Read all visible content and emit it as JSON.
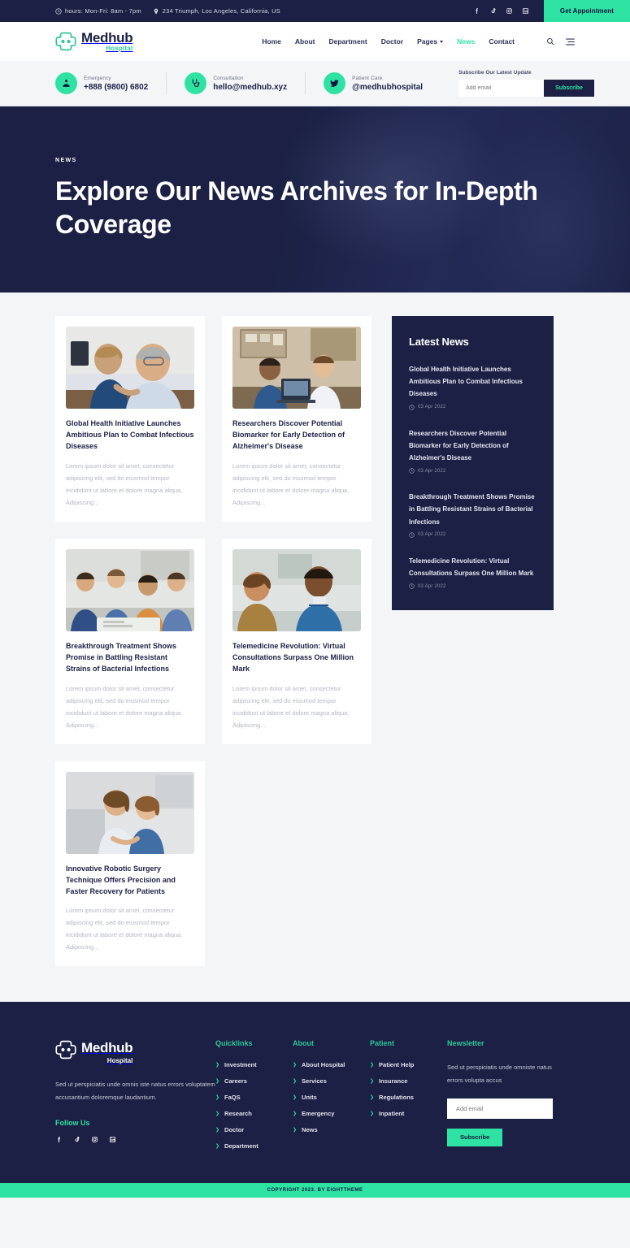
{
  "topbar": {
    "hours": "hours: Mon-Fri: 8am - 7pm",
    "address": "234 Triumph, Los Angeles, California, US",
    "clock_icon": "clock-icon",
    "pin_icon": "map-pin-icon",
    "socials": [
      "facebook-icon",
      "tiktok-icon",
      "instagram-icon",
      "linkedin-icon"
    ],
    "appointment_label": "Get Appointment"
  },
  "header": {
    "logo_name": "Medhub",
    "logo_sub": "Hospital",
    "nav": [
      {
        "label": "Home",
        "active": false,
        "caret": false
      },
      {
        "label": "About",
        "active": false,
        "caret": false
      },
      {
        "label": "Department",
        "active": false,
        "caret": false
      },
      {
        "label": "Doctor",
        "active": false,
        "caret": false
      },
      {
        "label": "Pages",
        "active": false,
        "caret": true
      },
      {
        "label": "News",
        "active": true,
        "caret": false
      },
      {
        "label": "Contact",
        "active": false,
        "caret": false
      }
    ],
    "search_icon": "search-icon",
    "menu_icon": "hamburger-menu-icon"
  },
  "infobar": {
    "items": [
      {
        "label": "Emergency",
        "value": "+888 (9800) 6802",
        "icon": "ambulance-icon"
      },
      {
        "label": "Consultation",
        "value": "hello@medhub.xyz",
        "icon": "stethoscope-icon"
      },
      {
        "label": "Patient Care",
        "value": "@medhubhospital",
        "icon": "twitter-bird-icon"
      }
    ],
    "subscribe_title": "Subscribe Our Latest Update",
    "email_placeholder": "Add email",
    "subscribe_label": "Subscribe"
  },
  "hero": {
    "eyebrow": "NEWS",
    "title": "Explore Our News Archives for In-Depth Coverage"
  },
  "articles": [
    {
      "title": "Global Health Initiative Launches Ambitious Plan to Combat Infectious Diseases",
      "excerpt": "Lorem ipsum dolor sit amet, consectetur adipiscing elit, sed do eiusmod tempor incididunt ut labore et dolore magna aliqua. Adipiscing...",
      "image": "nurse-comforting-elderly-patient"
    },
    {
      "title": "Researchers Discover Potential Biomarker for Early Detection of Alzheimer's Disease",
      "excerpt": "Lorem ipsum dolor sit amet, consectetur adipiscing elit, sed do eiusmod tempor incididunt ut labore et dolore magna aliqua. Adipiscing...",
      "image": "doctors-reviewing-scan-at-desk"
    },
    {
      "title": "Breakthrough Treatment Shows Promise in Battling Resistant Strains of Bacterial Infections",
      "excerpt": "Lorem ipsum dolor sit amet, consectetur adipiscing elit, sed do eiusmod tempor incididunt ut labore et dolore magna aliqua. Adipiscing...",
      "image": "medical-team-meeting-with-patient"
    },
    {
      "title": "Telemedicine Revolution: Virtual Consultations Surpass One Million Mark",
      "excerpt": "Lorem ipsum dolor sit amet, consectetur adipiscing elit, sed do eiusmod tempor incididunt ut labore et dolore magna aliqua. Adipiscing...",
      "image": "smiling-male-nurse-with-patient"
    },
    {
      "title": "Innovative Robotic Surgery Technique Offers Precision and Faster Recovery for Patients",
      "excerpt": "Lorem ipsum dolor sit amet, consectetur adipiscing elit, sed do eiusmod tempor incididunt ut labore et dolore magna aliqua. Adipiscing...",
      "image": "doctor-consulting-young-patient"
    }
  ],
  "sidebar": {
    "title": "Latest News",
    "date_icon": "clock-icon",
    "items": [
      {
        "title": "Global Health Initiative Launches Ambitious Plan to Combat Infectious Diseases",
        "date": "03 Apr 2022"
      },
      {
        "title": "Researchers Discover Potential Biomarker for Early Detection of Alzheimer's Disease",
        "date": "03 Apr 2022"
      },
      {
        "title": "Breakthrough Treatment Shows Promise in Battling Resistant Strains of Bacterial Infections",
        "date": "03 Apr 2022"
      },
      {
        "title": "Telemedicine Revolution: Virtual Consultations Surpass One Million Mark",
        "date": "03 Apr 2022"
      }
    ]
  },
  "footer": {
    "logo_name": "Medhub",
    "logo_sub": "Hospital",
    "description": "Sed ut perspiciatis unde omnis iste natus errors voluptatem accusantium doloremque laudantium.",
    "follow_label": "Follow Us",
    "socials": [
      "facebook-icon",
      "tiktok-icon",
      "instagram-icon",
      "linkedin-icon"
    ],
    "columns": [
      {
        "head": "Quicklinks",
        "links": [
          "Investment",
          "Careers",
          "FaQS",
          "Research",
          "Doctor",
          "Department"
        ]
      },
      {
        "head": "About",
        "links": [
          "About Hospital",
          "Services",
          "Units",
          "Emergency",
          "News"
        ]
      },
      {
        "head": "Patient",
        "links": [
          "Patient Help",
          "Insurance",
          "Regulations",
          "Inpatient"
        ]
      }
    ],
    "newsletter": {
      "head": "Newsletter",
      "description": "Sed ut perspiciatis unde omniste natus errors volupta accus",
      "email_placeholder": "Add email",
      "button_label": "Subscribe"
    }
  },
  "copyright": "COPYRIGHT 2023. BY EIGHTTHEME",
  "colors": {
    "navy": "#1b2044",
    "mint": "#2ee2a4",
    "teal": "#2ec49a",
    "page_bg": "#f4f5f7"
  }
}
